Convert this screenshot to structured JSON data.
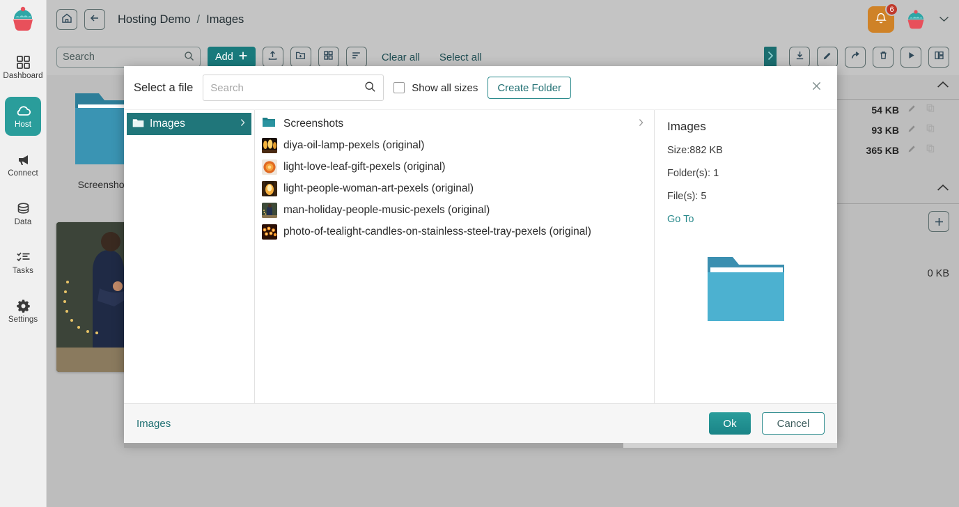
{
  "app": {
    "accent": "#2a9d9b",
    "accent_dark": "#197a7c",
    "header_bg": "#c4c4c4",
    "content_bg": "#bdbdbd"
  },
  "sidebar": {
    "logo_name": "cupcake-logo",
    "items": [
      {
        "label": "Dashboard",
        "icon": "grid-icon",
        "active": false
      },
      {
        "label": "Host",
        "icon": "cloud-icon",
        "active": true
      },
      {
        "label": "Connect",
        "icon": "megaphone-icon",
        "active": false
      },
      {
        "label": "Data",
        "icon": "database-icon",
        "active": false
      },
      {
        "label": "Tasks",
        "icon": "checklist-icon",
        "active": false
      },
      {
        "label": "Settings",
        "icon": "gear-icon",
        "active": false
      }
    ]
  },
  "header": {
    "home_icon": "home-icon",
    "back_icon": "arrow-left-icon",
    "breadcrumb": [
      "Hosting Demo",
      "Images"
    ],
    "separator": "/",
    "bell_icon": "bell-icon",
    "notification_count": "6",
    "avatar": "user-avatar",
    "caret_icon": "chevron-down-icon"
  },
  "toolbar": {
    "search_placeholder": "Search",
    "search_icon": "search-icon",
    "add_label": "Add",
    "add_icon": "plus-icon",
    "upload_icon": "upload-icon",
    "new_folder_icon": "folder-plus-icon",
    "grid_view_icon": "grid-view-icon",
    "sort_icon": "sort-icon",
    "clear_all_label": "Clear all",
    "select_all_label": "Select all",
    "panel_toggle_icon": "chevron-right-icon",
    "right_actions": [
      {
        "icon": "download-icon"
      },
      {
        "icon": "pencil-icon"
      },
      {
        "icon": "share-icon"
      },
      {
        "icon": "trash-icon"
      },
      {
        "icon": "play-icon"
      },
      {
        "icon": "layout-icon"
      }
    ]
  },
  "content": {
    "folder_card_label": "Screenshots",
    "right_panel": {
      "sizes": [
        "54 KB",
        "93 KB",
        "365 KB"
      ],
      "total_size": "0 KB",
      "row_edit_icon": "pencil-icon",
      "row_copy_icon": "copy-icon",
      "add_icon": "plus-icon",
      "collapse_icon": "chevron-up-icon"
    }
  },
  "modal": {
    "title": "Select a file",
    "search_placeholder": "Search",
    "search_icon": "search-icon",
    "show_all_sizes_label": "Show all sizes",
    "show_all_sizes_checked": false,
    "create_folder_label": "Create Folder",
    "close_icon": "close-icon",
    "tree": [
      {
        "label": "Images",
        "icon": "folder-icon",
        "selected": true,
        "chevron": "chevron-right-icon"
      }
    ],
    "files": [
      {
        "name": "Screenshots",
        "type": "folder",
        "icon": "folder-icon",
        "has_chevron": true
      },
      {
        "name": "diya-oil-lamp-pexels (original)",
        "type": "image",
        "thumb": "diya-oil-lamp"
      },
      {
        "name": "light-love-leaf-gift-pexels (original)",
        "type": "image",
        "thumb": "light-love-leaf-gift"
      },
      {
        "name": "light-people-woman-art-pexels (original)",
        "type": "image",
        "thumb": "light-people-woman-art"
      },
      {
        "name": "man-holiday-people-music-pexels (original)",
        "type": "image",
        "thumb": "man-holiday-people-music"
      },
      {
        "name": "photo-of-tealight-candles-on-stainless-steel-tray-pexels (original)",
        "type": "image",
        "thumb": "photo-of-tealight-candles"
      }
    ],
    "detail": {
      "title": "Images",
      "size": "Size:882 KB",
      "folders": "Folder(s): 1",
      "files": "File(s): 5",
      "goto_label": "Go To",
      "preview_icon": "folder-icon"
    },
    "footer": {
      "path": "Images",
      "ok_label": "Ok",
      "cancel_label": "Cancel"
    }
  }
}
